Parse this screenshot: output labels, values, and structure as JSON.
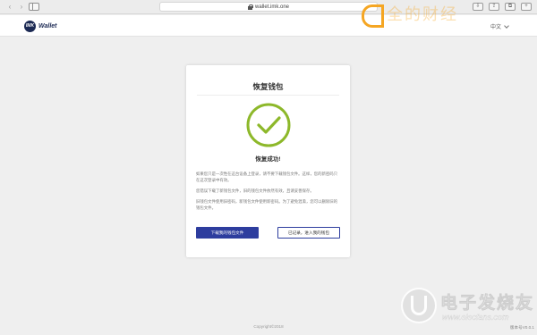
{
  "browser": {
    "url": "wallet.imk.one",
    "back_glyph": "‹",
    "forward_glyph": "›",
    "tools": [
      "⇩",
      "⇪",
      "⧉",
      "+"
    ]
  },
  "header": {
    "logo_badge": "IMK",
    "logo_text": "Wallet",
    "language": "中文"
  },
  "watermark_top": "全的财经",
  "card": {
    "title": "恢复钱包",
    "success_title": "恢复成功!",
    "paragraphs": [
      "如果您只是一次性在这台设备上登录，请不要下载钱包文件。这样，您的新密码只在这次登录中有效。",
      "您错误下载了新钱包文件，旧的钱包文件依然有效，且请妥善保存。",
      "旧钱包文件使用旧密码，新钱包文件使用新密码。为了避免混淆，您可以删除旧的钱包文件。"
    ],
    "primary_button": "下载我的钱包文件",
    "secondary_button": "已记录，进入我的钱包",
    "check_color": "#8db82a"
  },
  "footer": {
    "copyright": "Copyright©2018",
    "version": "版本号V0.0.1"
  },
  "watermark_bottom": {
    "text": "电子发烧友",
    "sub": "www.elecfans.com"
  }
}
